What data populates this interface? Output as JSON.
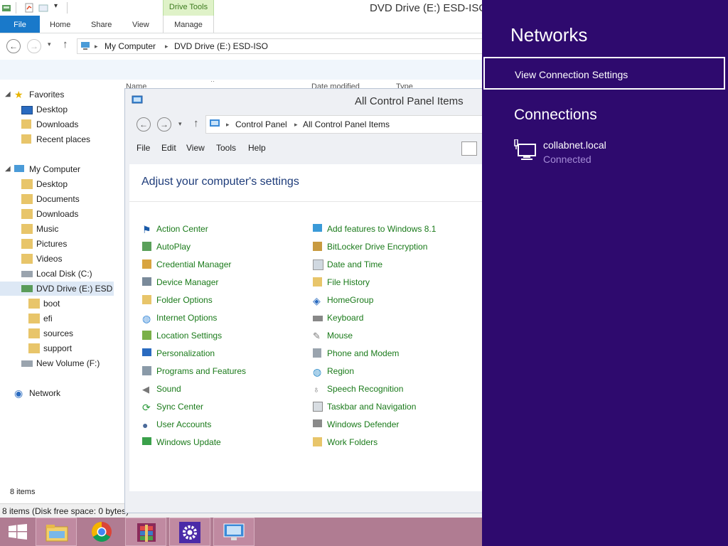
{
  "explorer": {
    "title": "DVD Drive (E:) ESD-ISO",
    "context_tab": "Drive Tools",
    "tabs": [
      "File",
      "Home",
      "Share",
      "View",
      "Manage"
    ],
    "address": [
      "My Computer",
      "DVD Drive (E:) ESD-ISO"
    ],
    "columns": [
      "Name",
      "Date modified",
      "Type"
    ],
    "nav": {
      "favorites": "Favorites",
      "fav_items": [
        "Desktop",
        "Downloads",
        "Recent places"
      ],
      "computer": "My Computer",
      "computer_items": [
        "Desktop",
        "Documents",
        "Downloads",
        "Music",
        "Pictures",
        "Videos",
        "Local Disk (C:)",
        "DVD Drive (E:) ESD-ISO"
      ],
      "dvd_children": [
        "boot",
        "efi",
        "sources",
        "support"
      ],
      "new_volume": "New Volume (F:)",
      "network": "Network"
    },
    "item_count": "8 items",
    "status": "8 items (Disk free space: 0 bytes)"
  },
  "control_panel": {
    "title": "All Control Panel Items",
    "address": [
      "Control Panel",
      "All Control Panel Items"
    ],
    "menu": [
      "File",
      "Edit",
      "View",
      "Tools",
      "Help"
    ],
    "heading": "Adjust your computer's settings",
    "left_items": [
      "Action Center",
      "AutoPlay",
      "Credential Manager",
      "Device Manager",
      "Folder Options",
      "Internet Options",
      "Location Settings",
      "Personalization",
      "Programs and Features",
      "Sound",
      "Sync Center",
      "User Accounts",
      "Windows Update"
    ],
    "right_items": [
      "Add features to Windows 8.1",
      "BitLocker Drive Encryption",
      "Date and Time",
      "File History",
      "HomeGroup",
      "Keyboard",
      "Mouse",
      "Phone and Modem",
      "Region",
      "Speech Recognition",
      "Taskbar and Navigation",
      "Windows Defender",
      "Work Folders"
    ]
  },
  "networks": {
    "title": "Networks",
    "view_settings": "View Connection Settings",
    "connections_header": "Connections",
    "network_name": "collabnet.local",
    "network_status": "Connected"
  },
  "taskbar": {
    "items": [
      "start-icon",
      "file-explorer-icon",
      "chrome-icon",
      "winrar-icon",
      "settings-icon",
      "control-panel-icon"
    ]
  },
  "colors": {
    "charms_bg": "#2e0a6e",
    "file_tab": "#1979ca",
    "taskbar": "#b07c92",
    "link_green": "#1a7a1a",
    "heading_blue": "#1e3c7a"
  }
}
